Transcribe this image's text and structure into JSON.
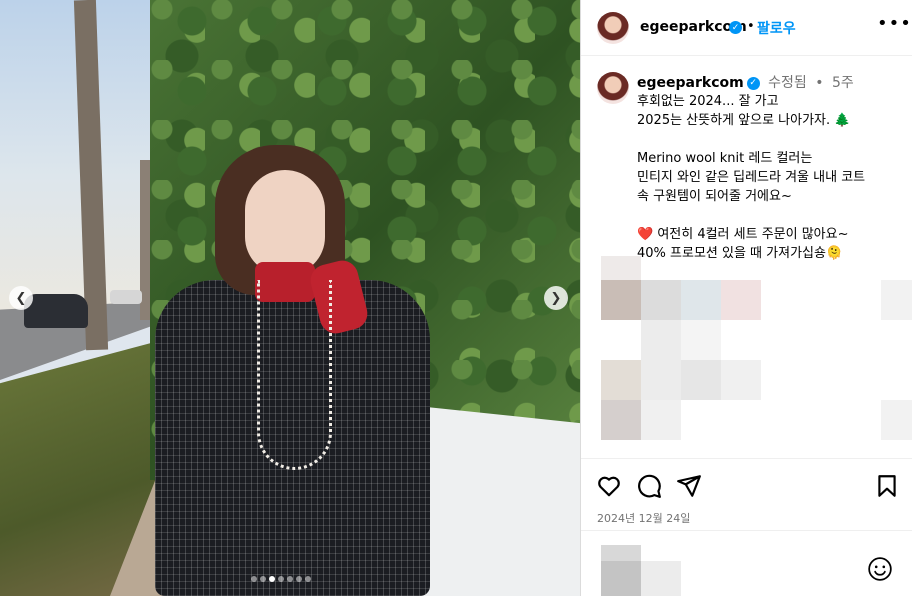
{
  "post": {
    "username": "egeeparkcom",
    "follow_label": "팔로우",
    "separator": "•",
    "edited_label": "수정됨",
    "age": "5주",
    "caption": "후회없는 2024... 잘 가고\n2025는 산뜻하게 앞으로 나아가자. 🌲\n\nMerino wool knit 레드 컬러는\n민티지 와인 같은 딥레드라 겨울 내내 코트\n속 구원템이 되어줄 거에요~\n\n❤️ 여전히 4컬러 세트 주문이 많아요~\n40% 프로모션 있을 때 가져가십숑🫠",
    "date": "2024년 12월 24일"
  },
  "icons": {
    "verified": "verified-badge-icon",
    "more": "more-options-icon",
    "like": "heart-icon",
    "comment": "comment-icon",
    "share": "send-icon",
    "save": "bookmark-icon",
    "emoji": "emoji-icon",
    "prev": "chevron-left-icon",
    "next": "chevron-right-icon"
  },
  "carousel": {
    "count": 7,
    "active": 2
  },
  "colors": {
    "accent": "#0095f6",
    "muted": "#737373",
    "border": "#dbdbdb"
  }
}
